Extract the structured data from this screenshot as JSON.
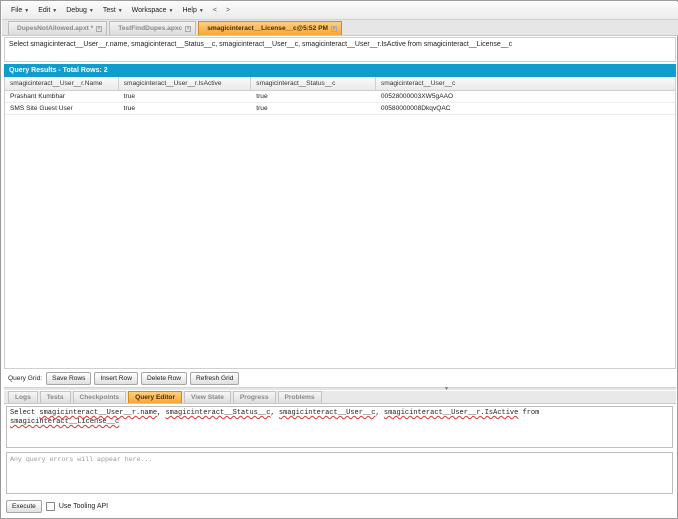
{
  "menu": {
    "items": [
      {
        "label": "File"
      },
      {
        "label": "Edit"
      },
      {
        "label": "Debug"
      },
      {
        "label": "Test"
      },
      {
        "label": "Workspace"
      },
      {
        "label": "Help"
      }
    ],
    "back": "<",
    "forward": ">"
  },
  "tabs": [
    {
      "label": "DupesNotAllowed.apxt *",
      "active": false
    },
    {
      "label": "TestFindDupes.apxc",
      "active": false
    },
    {
      "label": "smagicinteract__License__c@5:52 PM",
      "active": true
    }
  ],
  "top_query": "Select smagicinteract__User__r.name, smagicinteract__Status__c, smagicinteract__User__c, smagicinteract__User__r.IsActive from smagicinteract__License__c",
  "results": {
    "header": "Query Results - Total Rows: 2",
    "columns": [
      "smagicinteract__User__r.Name",
      "smagicinteract__User__r.IsActive",
      "smagicinteract__Status__c",
      "smagicinteract__User__c"
    ],
    "rows": [
      [
        "Prashant Kumbhar",
        "true",
        "true",
        "00528000003XW5gAAO"
      ],
      [
        "SMS Site Guest User",
        "true",
        "true",
        "00580000008DkqvQAC"
      ]
    ]
  },
  "grid_toolbar": {
    "label": "Query Grid:",
    "save_rows": "Save Rows",
    "insert_row": "Insert Row",
    "delete_row": "Delete Row",
    "refresh_grid": "Refresh Grid"
  },
  "panel_tabs": [
    {
      "label": "Logs",
      "active": false
    },
    {
      "label": "Tests",
      "active": false
    },
    {
      "label": "Checkpoints",
      "active": false
    },
    {
      "label": "Query Editor",
      "active": true
    },
    {
      "label": "View State",
      "active": false
    },
    {
      "label": "Progress",
      "active": false
    },
    {
      "label": "Problems",
      "active": false
    }
  ],
  "editor": {
    "line1_a": "Select ",
    "w1": "smagicinteract__User__r.name",
    "sep1": ", ",
    "w2": "smagicinteract__Status__c",
    "sep2": ", ",
    "w3": "smagicinteract__User__c",
    "sep3": ", ",
    "w4": "smagicinteract__User__r.IsActive",
    "line1_b": " from",
    "w5": "smagicinteract__License__c"
  },
  "errors_placeholder": "Any query errors will appear here...",
  "footer": {
    "execute": "Execute",
    "tooling_label": "Use Tooling API",
    "tooling_checked": false
  },
  "colors": {
    "results_header_bg": "#109ccd",
    "active_tab_bg": "#f6a637"
  }
}
